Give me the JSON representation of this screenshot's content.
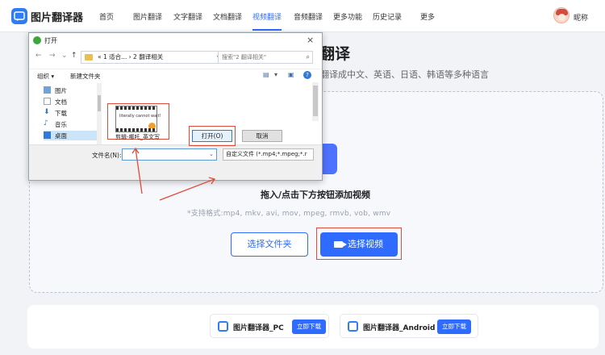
{
  "header": {
    "brand": "图片翻译器",
    "nav": [
      "首页",
      "图片翻译",
      "文字翻译",
      "文档翻译",
      "视频翻译",
      "音频翻译",
      "更多功能",
      "历史记录",
      "更多"
    ],
    "active_nav": "视频翻译",
    "username": "昵称"
  },
  "hero": {
    "heading": "翻译",
    "subheading": "并翻译成中文、英语、日语、韩语等多种语言"
  },
  "upload": {
    "title": "拖入/点击下方按钮添加视频",
    "formats": "*支持格式:mp4, mkv, avi, mov, mpeg, rmvb, vob, wmv",
    "folder_button": "选择文件夹",
    "video_button": "选择视频"
  },
  "downloads": [
    {
      "name": "图片翻译器_PC",
      "button": "立即下载"
    },
    {
      "name": "图片翻译器_Android",
      "button": "立即下载"
    }
  ],
  "dialog": {
    "title": "打开",
    "close": "×",
    "path": "« 1 适合... › 2 翻译相关",
    "search_placeholder": "搜索\"2 翻译相关\"",
    "toolbar": {
      "organize": "组织 ▾",
      "new_folder": "新建文件夹"
    },
    "tree": [
      {
        "label": "图片",
        "icon": "pictures-icon"
      },
      {
        "label": "文档",
        "icon": "documents-icon"
      },
      {
        "label": "下载",
        "icon": "downloads-icon"
      },
      {
        "label": "音乐",
        "icon": "music-icon"
      },
      {
        "label": "桌面",
        "icon": "desktop-icon"
      }
    ],
    "file": {
      "name": "剪辑-哪吒_英文写",
      "thumb_caption": "literally cannot wait!"
    },
    "filename_label": "文件名(N):",
    "filetype": "自定义文件 (*.mp4;*.mpeg;*.r",
    "open_button": "打开(O)",
    "cancel_button": "取消"
  },
  "colors": {
    "accent": "#2f6bff",
    "highlight": "#e04b3a"
  }
}
